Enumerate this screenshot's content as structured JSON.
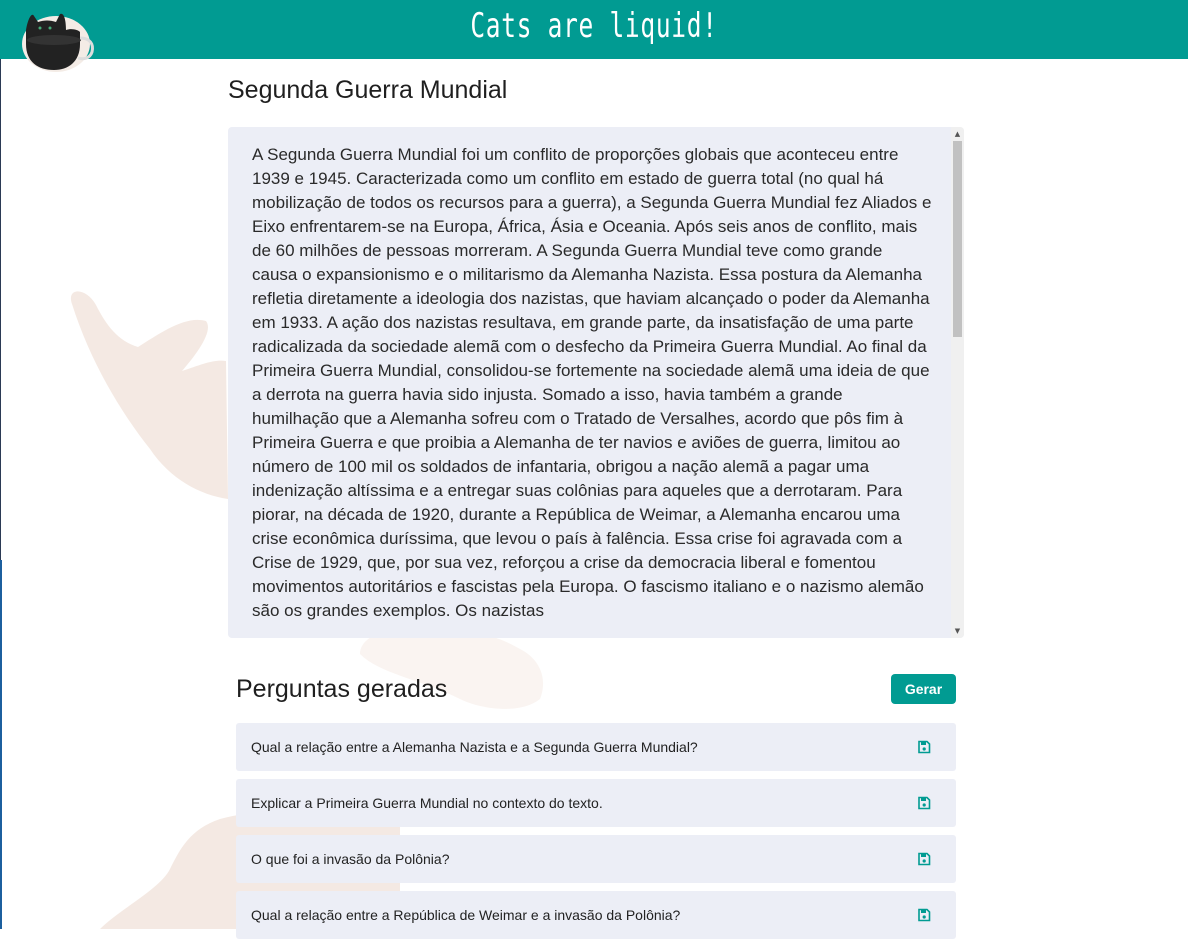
{
  "header": {
    "brand": "Cats are liquid!",
    "colors": {
      "accent": "#019b92",
      "text_box_bg": "#eceef6"
    }
  },
  "main": {
    "title": "Segunda Guerra Mundial",
    "text": "A Segunda Guerra Mundial foi um conflito de proporções globais que aconteceu entre 1939 e 1945. Caracterizada como um conflito em estado de guerra total (no qual há mobilização de todos os recursos para a guerra), a Segunda Guerra Mundial fez Aliados e Eixo enfrentarem-se na Europa, África, Ásia e Oceania. Após seis anos de conflito, mais de 60 milhões de pessoas morreram. A Segunda Guerra Mundial teve como grande causa o expansionismo e o militarismo da Alemanha Nazista. Essa postura da Alemanha refletia diretamente a ideologia dos nazistas, que haviam alcançado o poder da Alemanha em 1933. A ação dos nazistas resultava, em grande parte, da insatisfação de uma parte radicalizada da sociedade alemã com o desfecho da Primeira Guerra Mundial. Ao final da Primeira Guerra Mundial, consolidou-se fortemente na sociedade alemã uma ideia de que a derrota na guerra havia sido injusta. Somado a isso, havia também a grande humilhação que a Alemanha sofreu com o Tratado de Versalhes, acordo que pôs fim à Primeira Guerra e que proibia a Alemanha de ter navios e aviões de guerra, limitou ao número de 100 mil os soldados de infantaria, obrigou a nação alemã a pagar uma indenização altíssima e a entregar suas colônias para aqueles que a derrotaram. Para piorar, na década de 1920, durante a República de Weimar, a Alemanha encarou uma crise econômica duríssima, que levou o país à falência. Essa crise foi agravada com a Crise de 1929, que, por sua vez, reforçou a crise da democracia liberal e fomentou movimentos autoritários e fascistas pela Europa. O fascismo italiano e o nazismo alemão são os grandes exemplos. Os nazistas"
  },
  "questions": {
    "title": "Perguntas geradas",
    "generate_label": "Gerar",
    "items": [
      {
        "text": "Qual a relação entre a Alemanha Nazista e a Segunda Guerra Mundial?",
        "icon": "save-icon"
      },
      {
        "text": "Explicar a Primeira Guerra Mundial no contexto do texto.",
        "icon": "save-icon"
      },
      {
        "text": "O que foi a invasão da Polônia?",
        "icon": "save-icon"
      },
      {
        "text": "Qual a relação entre a República de Weimar e a invasão da Polônia?",
        "icon": "save-icon"
      }
    ]
  }
}
